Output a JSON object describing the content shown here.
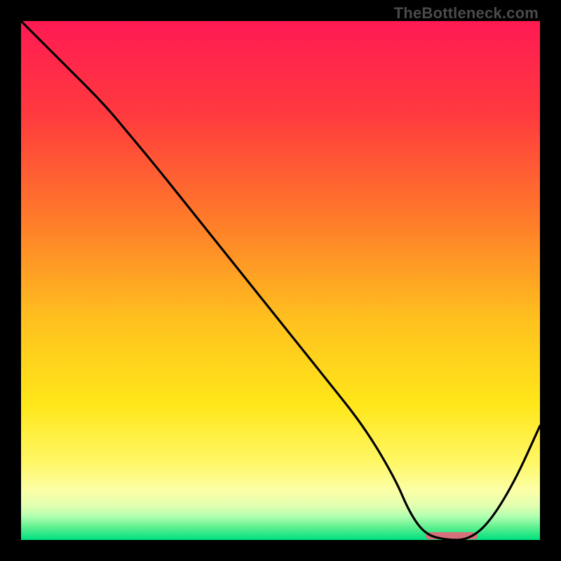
{
  "watermark": "TheBottleneck.com",
  "chart_data": {
    "type": "line",
    "title": "",
    "xlabel": "",
    "ylabel": "",
    "xlim": [
      0,
      100
    ],
    "ylim": [
      0,
      100
    ],
    "grid": false,
    "legend": false,
    "background_gradient_stops": [
      {
        "pct": 0.0,
        "color": "#ff1a53"
      },
      {
        "pct": 0.18,
        "color": "#ff3a3e"
      },
      {
        "pct": 0.38,
        "color": "#ff7a2a"
      },
      {
        "pct": 0.58,
        "color": "#ffc21e"
      },
      {
        "pct": 0.74,
        "color": "#ffe71a"
      },
      {
        "pct": 0.85,
        "color": "#fff765"
      },
      {
        "pct": 0.905,
        "color": "#fcffa8"
      },
      {
        "pct": 0.935,
        "color": "#e0ffb0"
      },
      {
        "pct": 0.955,
        "color": "#b0ffb0"
      },
      {
        "pct": 0.975,
        "color": "#60f090"
      },
      {
        "pct": 1.0,
        "color": "#00e080"
      }
    ],
    "series": [
      {
        "name": "curve",
        "color": "#000000",
        "x": [
          0,
          8,
          16,
          21,
          26,
          34,
          42,
          50,
          58,
          66,
          72,
          75,
          78,
          82,
          86,
          90,
          95,
          100
        ],
        "y": [
          100,
          92,
          84,
          78,
          72,
          62,
          52,
          42,
          32,
          22,
          12,
          5,
          1,
          0,
          0,
          3,
          11,
          22
        ]
      }
    ],
    "marker": {
      "name": "optimal-range",
      "color": "#d6707a",
      "x_start": 78,
      "x_end": 88,
      "y": 0.8,
      "thickness_pct": 1.4
    }
  }
}
